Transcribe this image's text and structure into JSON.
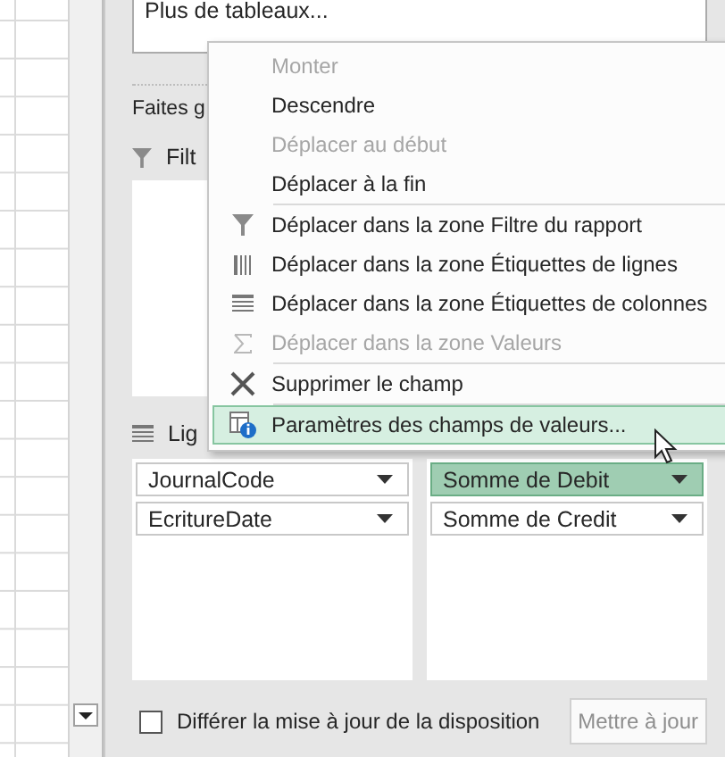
{
  "panel": {
    "more_tables": "Plus de tableaux...",
    "drag_hint": "Faites g",
    "filter_zone": "Filt",
    "rows_zone": "Lig",
    "row_fields": [
      {
        "label": "JournalCode",
        "selected": false
      },
      {
        "label": "EcritureDate",
        "selected": false
      }
    ],
    "value_fields": [
      {
        "label": "Somme de Debit",
        "selected": true
      },
      {
        "label": "Somme de Credit",
        "selected": false
      }
    ],
    "defer_update": {
      "label": "Différer la mise à jour de la disposition",
      "checked": false
    },
    "update_button": {
      "label": "Mettre à jour",
      "disabled": true
    }
  },
  "context_menu": [
    {
      "kind": "item",
      "label": "Monter",
      "disabled": true,
      "selected": false
    },
    {
      "kind": "item",
      "label": "Descendre",
      "disabled": false,
      "selected": false
    },
    {
      "kind": "item",
      "label": "Déplacer au début",
      "disabled": true,
      "selected": false
    },
    {
      "kind": "item",
      "label": "Déplacer à la fin",
      "disabled": false,
      "selected": false
    },
    {
      "kind": "separator"
    },
    {
      "kind": "item",
      "label": "Déplacer dans la zone Filtre du rapport",
      "disabled": false,
      "selected": false
    },
    {
      "kind": "item",
      "label": "Déplacer dans la zone Étiquettes de lignes",
      "disabled": false,
      "selected": false
    },
    {
      "kind": "item",
      "label": "Déplacer dans la zone Étiquettes de colonnes",
      "disabled": false,
      "selected": false
    },
    {
      "kind": "item",
      "label": "Déplacer dans la zone Valeurs",
      "disabled": true,
      "selected": false
    },
    {
      "kind": "separator"
    },
    {
      "kind": "item",
      "label": "Supprimer le champ",
      "disabled": false,
      "selected": false
    },
    {
      "kind": "separator"
    },
    {
      "kind": "item",
      "label": "Paramètres des champs de valeurs...",
      "disabled": false,
      "selected": true
    }
  ]
}
